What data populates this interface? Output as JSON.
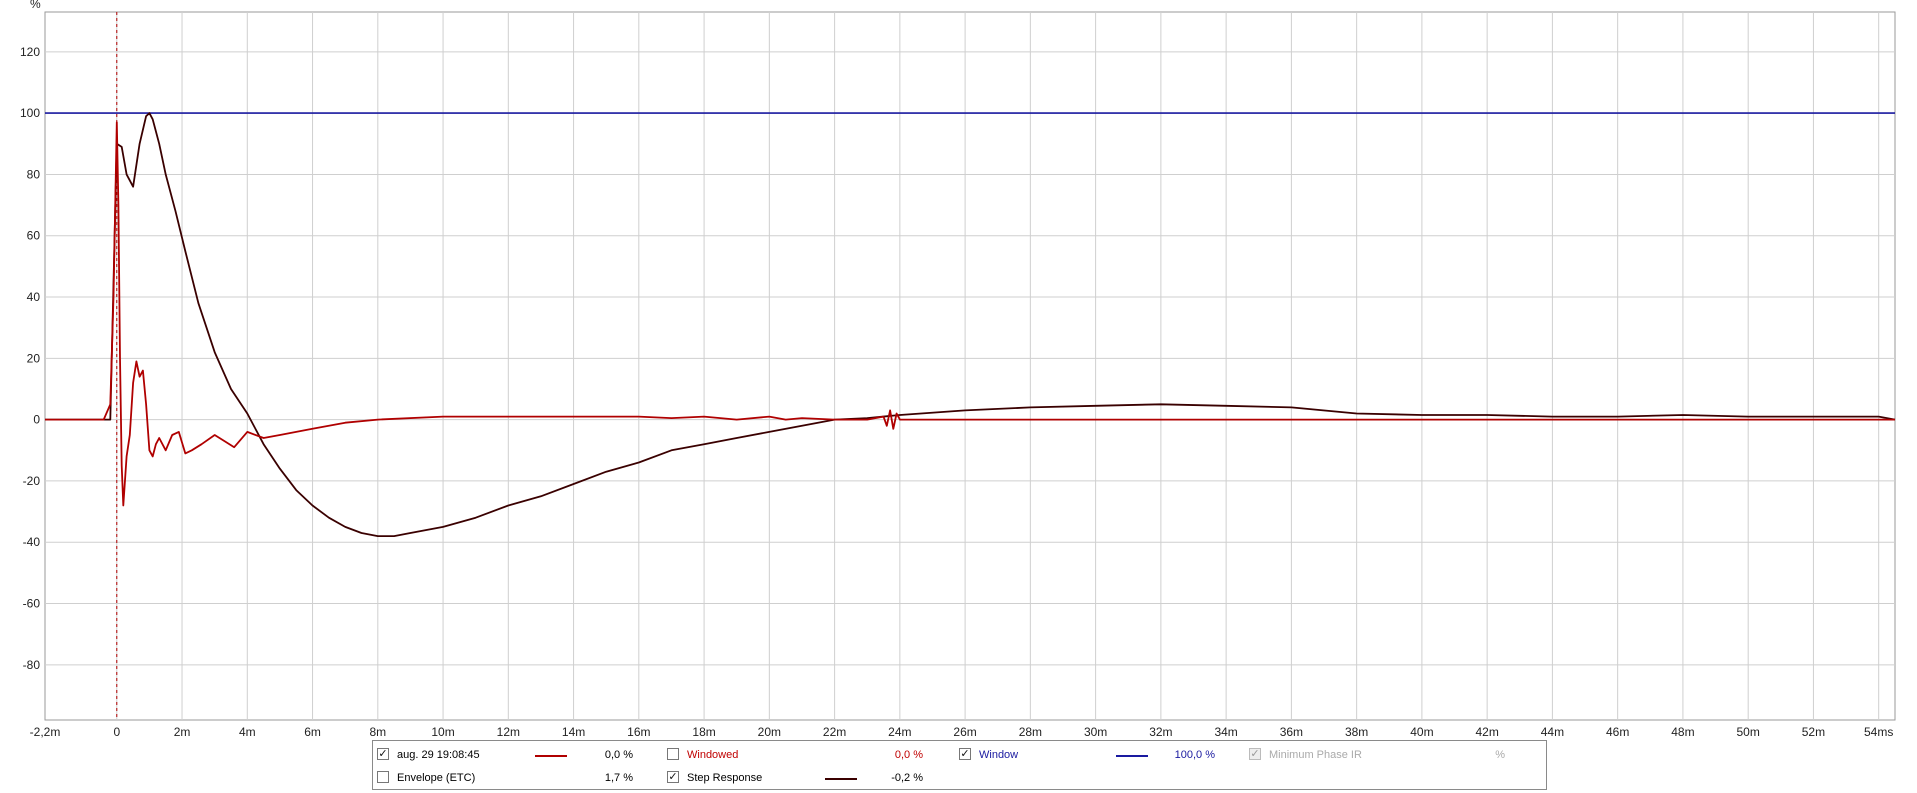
{
  "chart_data": {
    "type": "line",
    "y_unit_label": "%",
    "xlim": [
      -2.2,
      54.5
    ],
    "ylim": [
      -98,
      133
    ],
    "x_tick_values": [
      -2.2,
      0,
      2,
      4,
      6,
      8,
      10,
      12,
      14,
      16,
      18,
      20,
      22,
      24,
      26,
      28,
      30,
      32,
      34,
      36,
      38,
      40,
      42,
      44,
      46,
      48,
      50,
      52,
      54
    ],
    "x_tick_labels": [
      "-2,2m",
      "0",
      "2m",
      "4m",
      "6m",
      "8m",
      "10m",
      "12m",
      "14m",
      "16m",
      "18m",
      "20m",
      "22m",
      "24m",
      "26m",
      "28m",
      "30m",
      "32m",
      "34m",
      "36m",
      "38m",
      "40m",
      "42m",
      "44m",
      "46m",
      "48m",
      "50m",
      "52m",
      "54ms"
    ],
    "y_tick_values": [
      120,
      100,
      80,
      60,
      40,
      20,
      0,
      -20,
      -40,
      -60,
      -80
    ],
    "y_tick_labels": [
      "120",
      "100",
      "80",
      "60",
      "40",
      "20",
      "0",
      "-20",
      "-40",
      "-60",
      "-80"
    ],
    "grid": true,
    "marker_x": 0,
    "series": [
      {
        "name": "aug. 29 19:08:45",
        "color": "#b00000",
        "x": [
          -2.2,
          -0.4,
          -0.2,
          -0.1,
          0,
          0.05,
          0.1,
          0.15,
          0.2,
          0.3,
          0.4,
          0.5,
          0.6,
          0.7,
          0.8,
          0.9,
          1.0,
          1.1,
          1.2,
          1.3,
          1.5,
          1.7,
          1.9,
          2.1,
          2.3,
          2.6,
          3.0,
          3.3,
          3.6,
          4.0,
          4.5,
          5.0,
          6.0,
          7.0,
          8.0,
          10.0,
          12.0,
          14.0,
          16.0,
          17.0,
          18.0,
          18.5,
          19.0,
          20.0,
          20.5,
          21.0,
          22.0,
          23.0,
          23.5,
          23.6,
          23.7,
          23.8,
          23.9,
          24.0,
          25.0,
          27.0,
          30.0,
          33.0,
          36.0,
          38.0,
          40.0,
          42.0,
          44.0,
          46.0,
          48.0,
          50.0,
          52.0,
          54.0,
          54.5
        ],
        "y": [
          0,
          0,
          5,
          40,
          97,
          70,
          20,
          -15,
          -28,
          -12,
          -5,
          12,
          19,
          14,
          16,
          5,
          -10,
          -12,
          -8,
          -6,
          -10,
          -5,
          -4,
          -11,
          -10,
          -8,
          -5,
          -7,
          -9,
          -4,
          -6,
          -5,
          -3,
          -1,
          0,
          1,
          1,
          1,
          1,
          0.5,
          1,
          0.5,
          0,
          1,
          0,
          0.5,
          0,
          0,
          1,
          -2,
          3,
          -3,
          2,
          0,
          0,
          0,
          0,
          0,
          0,
          0,
          0,
          0,
          0,
          0,
          0,
          0,
          0,
          0,
          0
        ]
      },
      {
        "name": "Step Response",
        "color": "#3a0000",
        "x": [
          -2.2,
          -0.2,
          0,
          0.15,
          0.3,
          0.5,
          0.7,
          0.9,
          1.0,
          1.1,
          1.3,
          1.5,
          1.8,
          2.1,
          2.5,
          3.0,
          3.5,
          4.0,
          4.5,
          5.0,
          5.5,
          6.0,
          6.5,
          7.0,
          7.5,
          8.0,
          8.5,
          9.0,
          10.0,
          11.0,
          12.0,
          13.0,
          14.0,
          15.0,
          16.0,
          17.0,
          18.0,
          19.0,
          20.0,
          21.0,
          22.0,
          23.0,
          24.0,
          26.0,
          28.0,
          30.0,
          32.0,
          34.0,
          36.0,
          38.0,
          40.0,
          42.0,
          44.0,
          46.0,
          48.0,
          50.0,
          52.0,
          54.0,
          54.5
        ],
        "y": [
          0,
          0,
          90,
          89,
          80,
          76,
          90,
          99,
          100,
          98,
          90,
          80,
          68,
          55,
          38,
          22,
          10,
          2,
          -8,
          -16,
          -23,
          -28,
          -32,
          -35,
          -37,
          -38,
          -38,
          -37,
          -35,
          -32,
          -28,
          -25,
          -21,
          -17,
          -14,
          -10,
          -8,
          -6,
          -4,
          -2,
          0,
          0.5,
          1.5,
          3,
          4,
          4.5,
          5,
          4.5,
          4,
          2,
          1.5,
          1.5,
          1,
          1,
          1.5,
          1,
          1,
          1,
          0
        ]
      },
      {
        "name": "Window",
        "color": "#1a1aa0",
        "x": [
          -2.2,
          54.5
        ],
        "y": [
          100,
          100
        ]
      }
    ]
  },
  "legend": {
    "items": [
      {
        "label": "aug. 29 19:08:45",
        "checked": true,
        "value": "0,0 %",
        "color": "#b00000",
        "label_color": "#222222"
      },
      {
        "label": "Windowed",
        "checked": false,
        "value": "0,0 %",
        "color": "",
        "label_color": "#c00000"
      },
      {
        "label": "Window",
        "checked": true,
        "value": "100,0 %",
        "color": "#1a1aa0",
        "label_color": "#1a1aa0"
      },
      {
        "label": "Minimum Phase IR",
        "checked": true,
        "disabled": true,
        "value": "%",
        "color": "",
        "label_color": "#aaaaaa"
      },
      {
        "label": "Envelope (ETC)",
        "checked": false,
        "value": "1,7 %",
        "color": "",
        "label_color": "#222222"
      },
      {
        "label": "Step Response",
        "checked": true,
        "value": "-0,2 %",
        "color": "#3a0000",
        "label_color": "#222222"
      }
    ]
  }
}
